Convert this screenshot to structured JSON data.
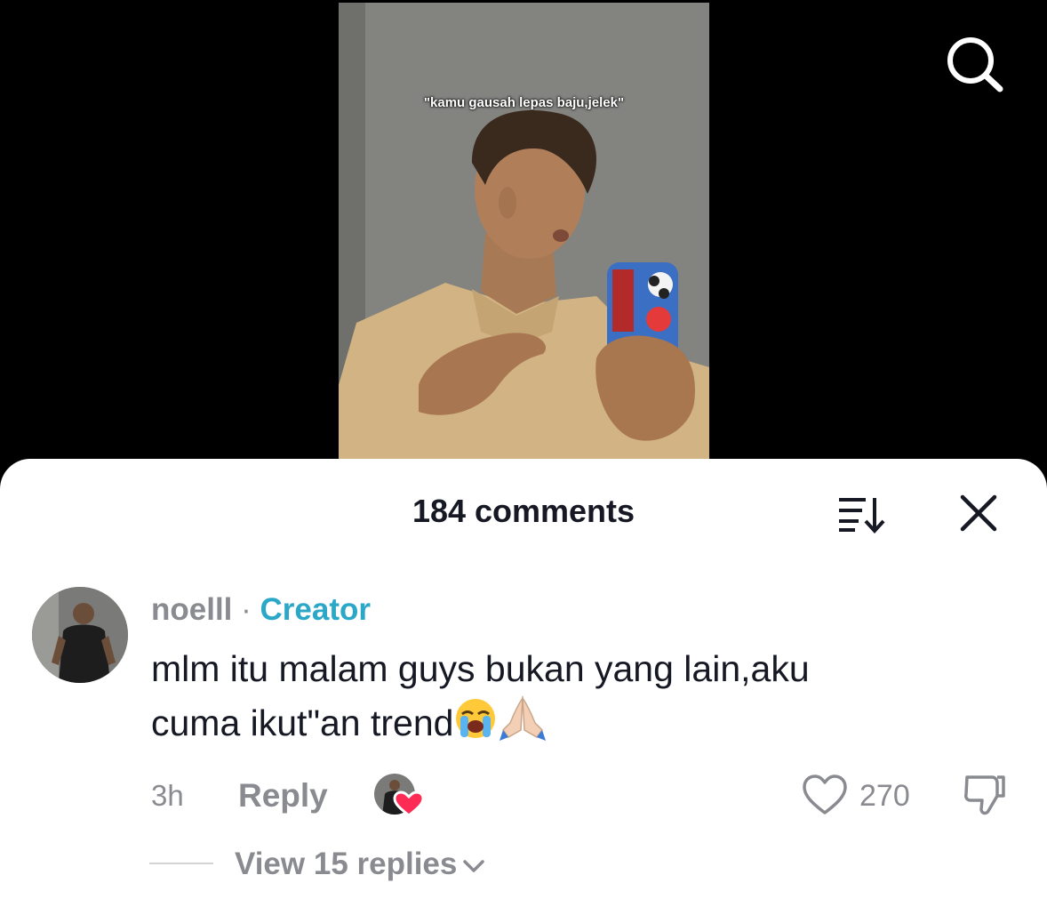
{
  "video": {
    "caption": "\"kamu gausah lepas baju,jelek\""
  },
  "top_bar": {
    "search_icon": "search-icon"
  },
  "comments_sheet": {
    "title": "184 comments",
    "sort_icon": "sort-icon",
    "close_icon": "close-icon",
    "comment": {
      "username": "noelll",
      "separator": "·",
      "badge": "Creator",
      "text_line1": "mlm itu malam guys bukan yang lain,aku",
      "text_line2": "cuma ikut\"an trend",
      "emojis": [
        "loudly-crying-face",
        "folded-hands"
      ],
      "time": "3h",
      "reply_label": "Reply",
      "like_count": "270",
      "view_replies_label": "View 15 replies"
    }
  },
  "colors": {
    "creator_accent": "#2ba7c7",
    "muted_text": "#8a8b91",
    "primary_text": "#161823",
    "like_heart": "#fe2c55"
  }
}
